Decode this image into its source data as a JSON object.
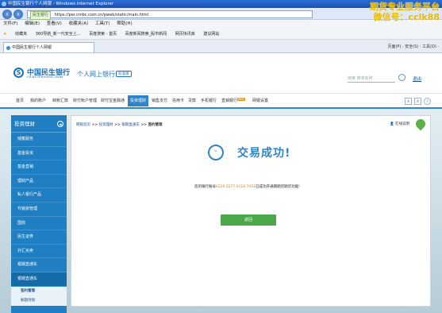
{
  "window": {
    "title": "中国民生银行个人网银 - Windows Internet Explorer"
  },
  "browser": {
    "address_tag": "民生银行",
    "url": "https://per.cmbc.com.cn/pweb/static/main.html",
    "menu": [
      "文件(F)",
      "编辑(E)",
      "查看(V)",
      "收藏夹(A)",
      "工具(T)",
      "帮助(H)"
    ],
    "favorites": [
      "收藏夹",
      "360导航_新一代安全上...",
      "百度搜索 - 首页",
      "百度新闻搜索_股市新闻",
      "网页快讯库",
      "建议网站"
    ],
    "tab_label": "中国民生银行个人网银",
    "tools_text": "页面(P) · 安全(S) · 工具(O) ·"
  },
  "watermark": {
    "line1": "期货专业服务平台",
    "line2": "微信号：cclk88"
  },
  "bank": {
    "name_cn": "中国民生银行",
    "name_en": "CHINA MINSHENG BANK",
    "site_title": "个人网上银行",
    "version": "标准版",
    "search_placeholder": "搜索 菜单名称",
    "logout": "退出"
  },
  "nav": [
    {
      "label": "首页",
      "active": false
    },
    {
      "label": "我的账户",
      "active": false
    },
    {
      "label": "转账汇款",
      "active": false
    },
    {
      "label": "财付账户管理",
      "active": false
    },
    {
      "label": "财付宝金融通",
      "active": false
    },
    {
      "label": "投资理财",
      "active": true
    },
    {
      "label": "销售支付",
      "active": false
    },
    {
      "label": "信用卡",
      "active": false
    },
    {
      "label": "贷款",
      "active": false
    },
    {
      "label": "手机银行",
      "active": false
    },
    {
      "label": "直销银行",
      "active": false,
      "badge": "HOT"
    },
    {
      "label": "网银设置",
      "active": false
    }
  ],
  "nav_ctrl": [
    "A",
    "A",
    "?"
  ],
  "sidebar": {
    "heading": "投资理财",
    "items": [
      "储蓄服务",
      "基金投资",
      "基金直销",
      "理财产品",
      "私人银行产品",
      "代销资管理",
      "国债",
      "民生证券",
      "外汇买卖",
      "银期直通车",
      "银期直通车"
    ],
    "sub": [
      "签约管理",
      "解题持钱"
    ]
  },
  "breadcrumb": {
    "parts": [
      "网银首页",
      "投资理财",
      "银期直通车",
      "签约管理"
    ],
    "sep": " >> "
  },
  "help_text": "在线说明",
  "result": {
    "title": "交易成功!",
    "msg_prefix": "您的银行账号",
    "account": "6226 2277 0120 7452",
    "msg_suffix": "已成功开通期期货期货功能!",
    "back": "返回"
  }
}
